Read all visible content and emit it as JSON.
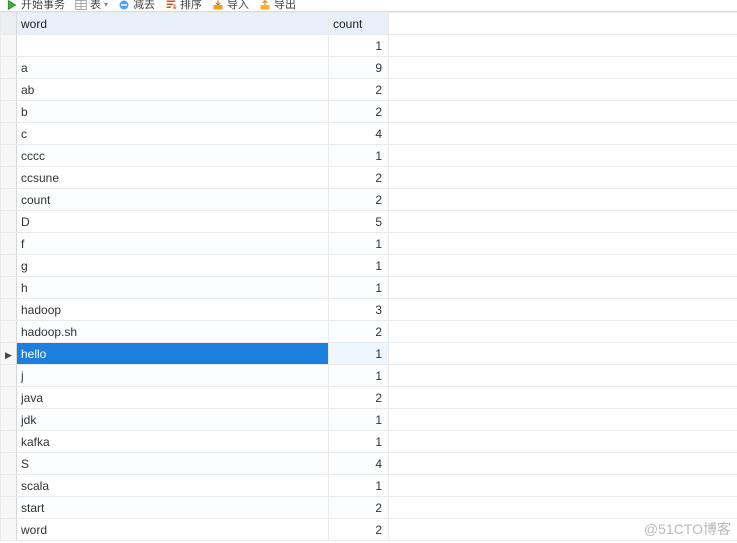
{
  "toolbar": {
    "items": [
      {
        "icon": "run",
        "color_a": "#3fae3f",
        "color_b": "#2e8b2e",
        "label": "开始事务",
        "caret": false
      },
      {
        "icon": "table",
        "color_a": "#c9c9c9",
        "color_b": "#8f8f8f",
        "label": "表",
        "caret": true
      },
      {
        "icon": "minus",
        "color_a": "#4aa3ff",
        "color_b": "#1a7fdd",
        "label": "减去",
        "caret": false
      },
      {
        "icon": "sort",
        "color_a": "#ff6a3d",
        "color_b": "#d94f27",
        "label": "排序",
        "caret": false
      },
      {
        "icon": "import",
        "color_a": "#f0a020",
        "color_b": "#c97e10",
        "label": "导入",
        "caret": false
      },
      {
        "icon": "export",
        "color_a": "#ffb020",
        "color_b": "#d08a10",
        "label": "导出",
        "caret": false
      }
    ]
  },
  "grid": {
    "headers": [
      {
        "key": "word",
        "label": "word"
      },
      {
        "key": "count",
        "label": "count"
      }
    ],
    "rows": [
      {
        "word": "",
        "count": 1
      },
      {
        "word": "a",
        "count": 9
      },
      {
        "word": "ab",
        "count": 2
      },
      {
        "word": "b",
        "count": 2
      },
      {
        "word": "c",
        "count": 4
      },
      {
        "word": "cccc",
        "count": 1
      },
      {
        "word": "ccsune",
        "count": 2
      },
      {
        "word": "count",
        "count": 2
      },
      {
        "word": "D",
        "count": 5
      },
      {
        "word": "f",
        "count": 1
      },
      {
        "word": "g",
        "count": 1
      },
      {
        "word": "h",
        "count": 1
      },
      {
        "word": "hadoop",
        "count": 3
      },
      {
        "word": "hadoop.sh",
        "count": 2
      },
      {
        "word": "hello",
        "count": 1,
        "selected": true
      },
      {
        "word": "j",
        "count": 1
      },
      {
        "word": "java",
        "count": 2
      },
      {
        "word": "jdk",
        "count": 1
      },
      {
        "word": "kafka",
        "count": 1
      },
      {
        "word": "S",
        "count": 4
      },
      {
        "word": "scala",
        "count": 1
      },
      {
        "word": "start",
        "count": 2
      },
      {
        "word": "word",
        "count": 2
      }
    ]
  },
  "watermark": "@51CTO博客"
}
